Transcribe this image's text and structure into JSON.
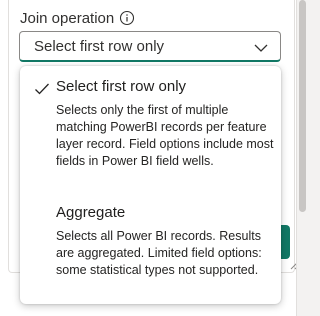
{
  "join_operation": {
    "label": "Join operation",
    "selected": "Select first row only"
  },
  "menu": {
    "options": [
      {
        "title": "Select first row only",
        "description": "Selects only the first of multiple matching PowerBI records per feature layer record. Field options include most fields in Power BI field wells.",
        "checked": true
      },
      {
        "title": "Aggregate",
        "description": "Selects all Power BI records. Results are aggregated. Limited field options: some statistical types not supported.",
        "checked": false
      }
    ]
  },
  "colors": {
    "accent": "#117865",
    "border": "#8a8886",
    "text": "#323130"
  },
  "icons": [
    "info-icon",
    "chevron-down-icon",
    "checkmark-icon",
    "resize-grip-icon"
  ]
}
